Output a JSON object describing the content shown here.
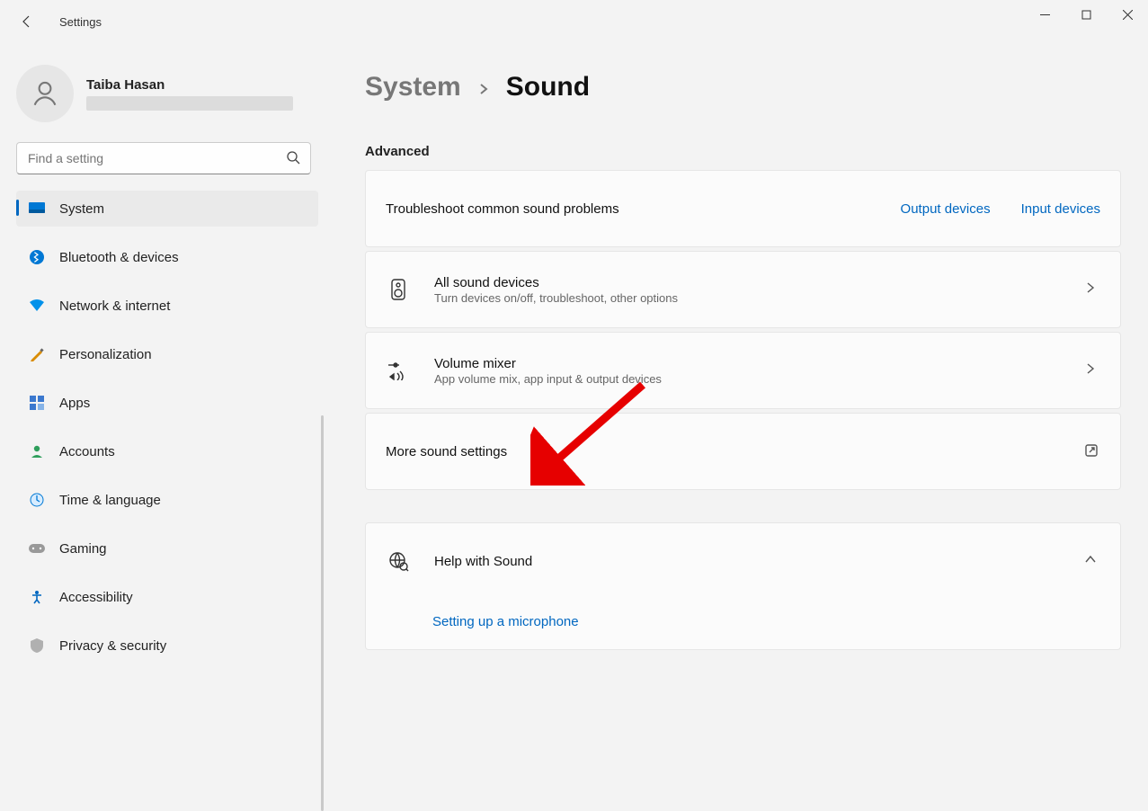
{
  "app": {
    "title": "Settings",
    "user_name": "Taiba Hasan"
  },
  "search": {
    "placeholder": "Find a setting"
  },
  "nav": {
    "items": [
      {
        "label": "System"
      },
      {
        "label": "Bluetooth & devices"
      },
      {
        "label": "Network & internet"
      },
      {
        "label": "Personalization"
      },
      {
        "label": "Apps"
      },
      {
        "label": "Accounts"
      },
      {
        "label": "Time & language"
      },
      {
        "label": "Gaming"
      },
      {
        "label": "Accessibility"
      },
      {
        "label": "Privacy & security"
      }
    ]
  },
  "breadcrumb": {
    "parent": "System",
    "current": "Sound"
  },
  "section": {
    "advanced": "Advanced"
  },
  "cards": {
    "troubleshoot": {
      "title": "Troubleshoot common sound problems",
      "link_output": "Output devices",
      "link_input": "Input devices"
    },
    "all_devices": {
      "title": "All sound devices",
      "subtitle": "Turn devices on/off, troubleshoot, other options"
    },
    "mixer": {
      "title": "Volume mixer",
      "subtitle": "App volume mix, app input & output devices"
    },
    "more": {
      "title": "More sound settings"
    },
    "help": {
      "title": "Help with Sound",
      "sublink": "Setting up a microphone"
    }
  }
}
